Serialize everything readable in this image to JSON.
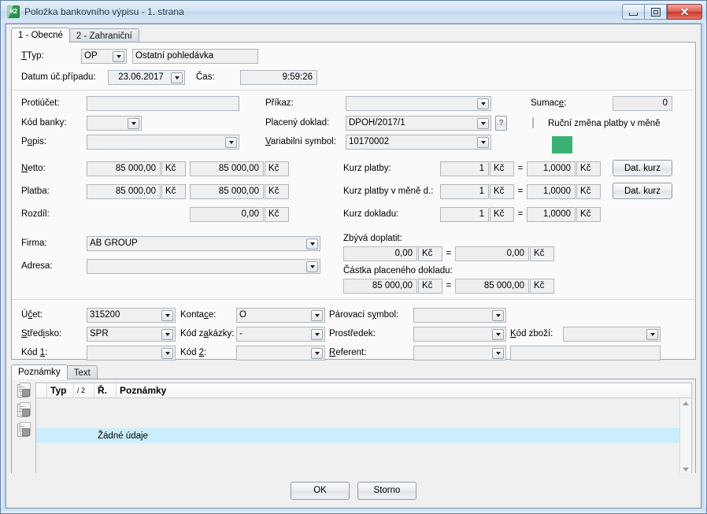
{
  "window": {
    "title": "Položka bankovního výpisu - 1. strana",
    "icon": "k2-app-icon",
    "controls": {
      "minimize": "minimize-icon",
      "maximize": "maximize-icon",
      "close": "close-icon"
    }
  },
  "tabs": [
    {
      "label": "1 - Obecné",
      "active": true
    },
    {
      "label": "2 - Zahraniční",
      "active": false
    }
  ],
  "form": {
    "typ": {
      "label": "Typ:",
      "code": "OP",
      "description": "Ostatní pohledávka"
    },
    "datum": {
      "label": "Datum úč.případu:",
      "value": "23.06.2017"
    },
    "cas": {
      "label": "Čas:",
      "value": "9:59:26"
    },
    "protiucet": {
      "label": "Protiúčet:",
      "value": ""
    },
    "kod_banky": {
      "label": "Kód banky:",
      "value": ""
    },
    "popis": {
      "label": "Popis:",
      "value": ""
    },
    "prikaz": {
      "label": "Příkaz:",
      "value": ""
    },
    "placeny_doklad": {
      "label": "Placený doklad:",
      "value": "DPOH/2017/1",
      "help": "?"
    },
    "variabilni_symbol": {
      "label": "Variabilní symbol:",
      "value": "10170002"
    },
    "sumace": {
      "label": "Sumace:",
      "value": "0"
    },
    "rucni_zmena": {
      "label": "Ruční změna platby v měně",
      "checked": false
    },
    "color_swatch": "#3bb273",
    "netto": {
      "label": "Netto:",
      "value1": "85 000,00",
      "unit1": "Kč",
      "value2": "85 000,00",
      "unit2": "Kč"
    },
    "platba": {
      "label": "Platba:",
      "value1": "85 000,00",
      "unit1": "Kč",
      "value2": "85 000,00",
      "unit2": "Kč"
    },
    "rozdil": {
      "label": "Rozdíl:",
      "value2": "0,00",
      "unit2": "Kč"
    },
    "kurz_platby": {
      "label": "Kurz platby:",
      "value1": "1",
      "unit1": "Kč",
      "eq": "=",
      "value2": "1,0000",
      "unit2": "Kč",
      "button": "Dat. kurz"
    },
    "kurz_platby_mene": {
      "label": "Kurz platby v měně d.:",
      "value1": "1",
      "unit1": "Kč",
      "eq": "=",
      "value2": "1,0000",
      "unit2": "Kč",
      "button": "Dat. kurz"
    },
    "kurz_dokladu": {
      "label": "Kurz dokladu:",
      "value1": "1",
      "unit1": "Kč",
      "eq": "=",
      "value2": "1,0000",
      "unit2": "Kč"
    },
    "zbyva_doplatit": {
      "label": "Zbývá doplatit:",
      "value1": "0,00",
      "unit1": "Kč",
      "eq": "=",
      "value2": "0,00",
      "unit2": "Kč"
    },
    "castka_placeneho": {
      "label": "Částka placeného dokladu:",
      "value1": "85 000,00",
      "unit1": "Kč",
      "eq": "=",
      "value2": "85 000,00",
      "unit2": "Kč"
    },
    "firma": {
      "label": "Firma:",
      "value": "AB GROUP"
    },
    "adresa": {
      "label": "Adresa:",
      "value": ""
    }
  },
  "accounting": {
    "ucet": {
      "label": "Účet:",
      "value": "315200"
    },
    "kontace": {
      "label": "Kontace:",
      "value": "O"
    },
    "parovaci_symbol": {
      "label": "Párovací symbol:",
      "value": ""
    },
    "stredisko": {
      "label": "Středisko:",
      "value": "SPR"
    },
    "kod_zakazky": {
      "label": "Kód zakázky:",
      "value": "-"
    },
    "prostredek": {
      "label": "Prostředek:",
      "value": ""
    },
    "kod_zbozi": {
      "label": "Kód zboží:",
      "value": ""
    },
    "kod1": {
      "label": "Kód 1:",
      "value": ""
    },
    "kod2": {
      "label": "Kód 2:",
      "value": ""
    },
    "referent": {
      "label": "Referent:",
      "value": "",
      "extra": ""
    }
  },
  "notes": {
    "tabs": [
      {
        "label": "Poznámky",
        "active": true
      },
      {
        "label": "Text",
        "active": false
      }
    ],
    "tools": [
      "copy-table-icon",
      "copy-image-icon",
      "copy-doc-icon"
    ],
    "columns": [
      "",
      "Typ",
      "/ 2",
      "Ř.",
      "Poznámky"
    ],
    "empty_message": "Žádné údaje"
  },
  "footer": {
    "ok": "OK",
    "cancel": "Storno"
  }
}
